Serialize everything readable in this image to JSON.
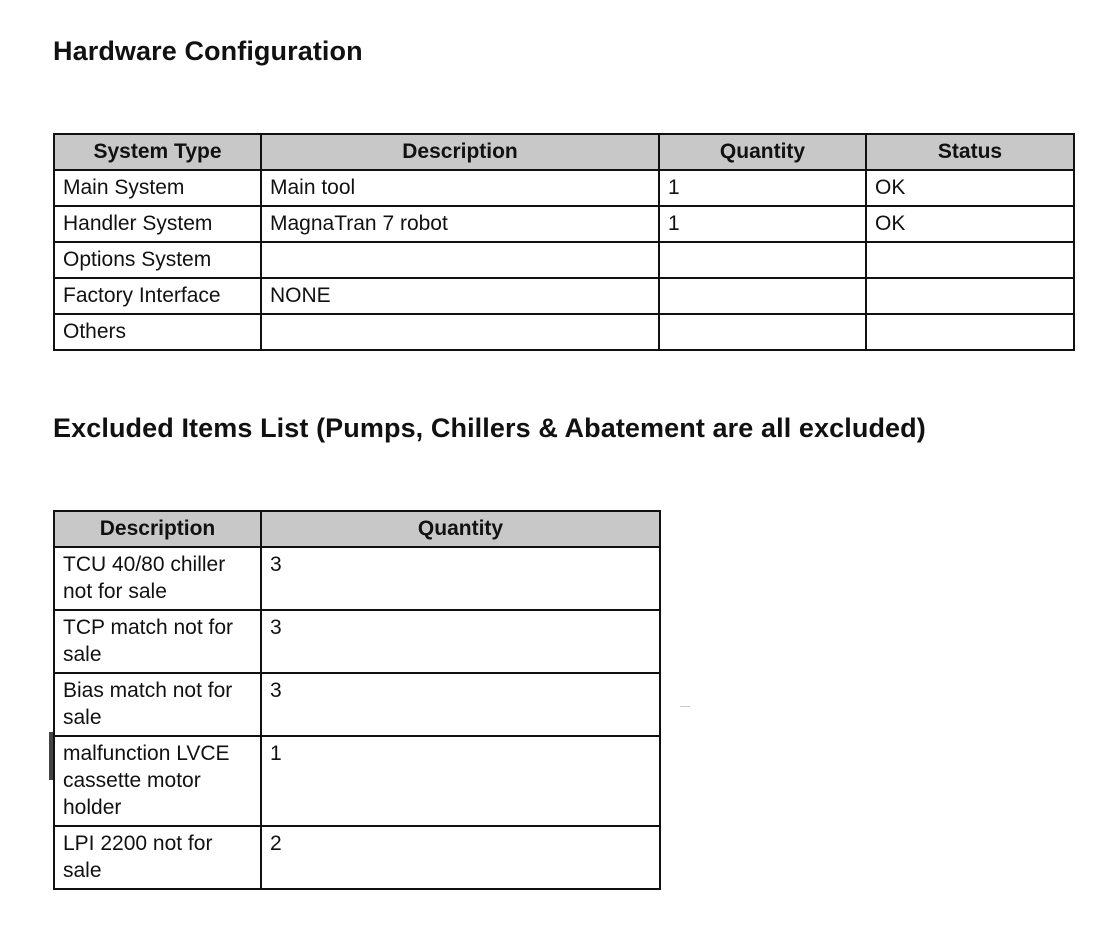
{
  "hardware": {
    "title": "Hardware Configuration",
    "columns": [
      "System Type",
      "Description",
      "Quantity",
      "Status"
    ],
    "rows": [
      {
        "system_type": "Main System",
        "description": "Main tool",
        "quantity": "1",
        "status": "OK"
      },
      {
        "system_type": "Handler System",
        "description": "MagnaTran 7 robot",
        "quantity": "1",
        "status": "OK"
      },
      {
        "system_type": "Options System",
        "description": "",
        "quantity": "",
        "status": ""
      },
      {
        "system_type": "Factory Interface",
        "description": "NONE",
        "quantity": "",
        "status": ""
      },
      {
        "system_type": "Others",
        "description": "",
        "quantity": "",
        "status": ""
      }
    ]
  },
  "excluded": {
    "title": "Excluded Items List (Pumps, Chillers & Abatement are all excluded)",
    "columns": [
      "Description",
      "Quantity"
    ],
    "rows": [
      {
        "description": "TCU 40/80 chiller not for sale",
        "quantity": "3"
      },
      {
        "description": "TCP match not for sale",
        "quantity": "3"
      },
      {
        "description": "Bias match not for sale",
        "quantity": "3"
      },
      {
        "description": "malfunction LVCE cassette motor holder",
        "quantity": "1"
      },
      {
        "description": "LPI 2200 not for sale",
        "quantity": "2"
      }
    ]
  },
  "colors": {
    "header_bg": "#c8c8c8",
    "border": "#111111",
    "text": "#111111"
  }
}
